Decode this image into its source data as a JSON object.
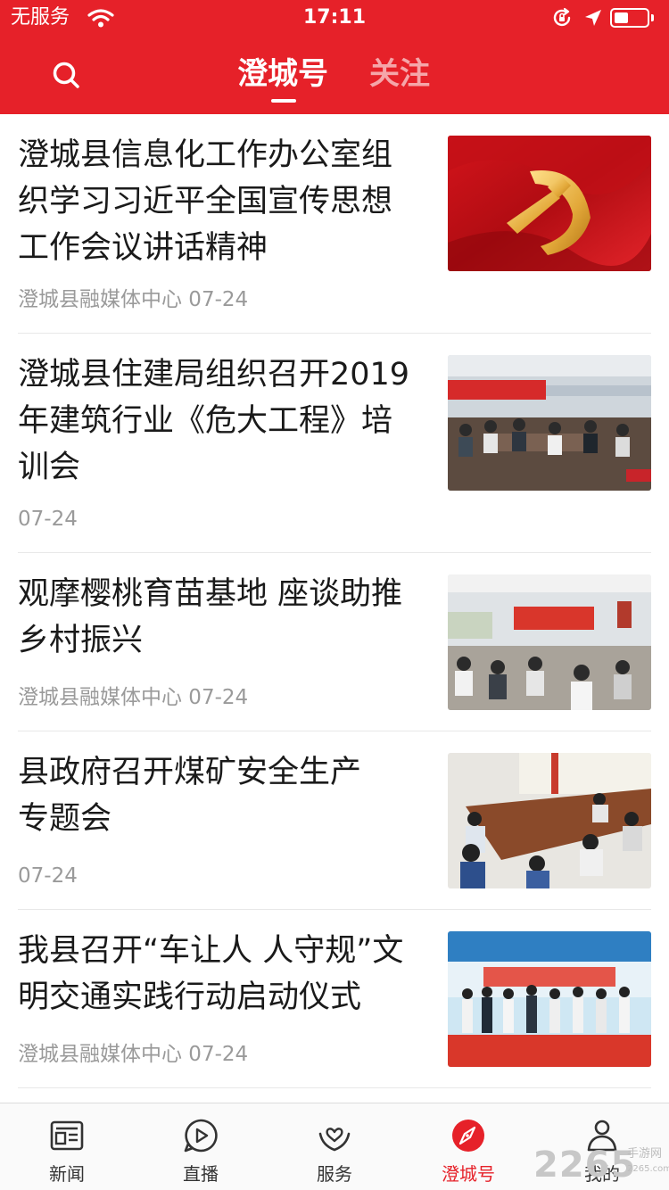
{
  "status_bar": {
    "carrier": "无服务",
    "time": "17:11",
    "battery_level": 0.45
  },
  "header": {
    "tabs": [
      {
        "label": "澄城号",
        "active": true
      },
      {
        "label": "关注",
        "active": false
      }
    ],
    "search_icon": "search-icon"
  },
  "feed": {
    "items": [
      {
        "title": "澄城县信息化工作办公室组织学习习近平全国宣传思想工作会议讲话精神",
        "meta": "澄城县融媒体中心 07-24"
      },
      {
        "title": "澄城县住建局组织召开2019年建筑行业《危大工程》培训会",
        "meta": "07-24"
      },
      {
        "title": "观摩樱桃育苗基地 座谈助推乡村振兴",
        "meta": "澄城县融媒体中心 07-24"
      },
      {
        "title": "县政府召开煤矿安全生产专题会",
        "meta": "07-24"
      },
      {
        "title": "我县召开“车让人 人守规”文明交通实践行动启动仪式",
        "meta": "澄城县融媒体中心 07-24"
      }
    ]
  },
  "bottom_nav": {
    "items": [
      {
        "label": "新闻",
        "icon": "newspaper-icon"
      },
      {
        "label": "直播",
        "icon": "play-icon"
      },
      {
        "label": "服务",
        "icon": "service-icon"
      },
      {
        "label": "澄城号",
        "icon": "compass-icon",
        "active": true
      },
      {
        "label": "我的",
        "icon": "user-icon"
      }
    ]
  },
  "watermark": {
    "text": "2265",
    "sub": "手游网",
    "url": "2265.com"
  },
  "colors": {
    "brand_red": "#e62129",
    "meta_gray": "#9a9a9a"
  }
}
